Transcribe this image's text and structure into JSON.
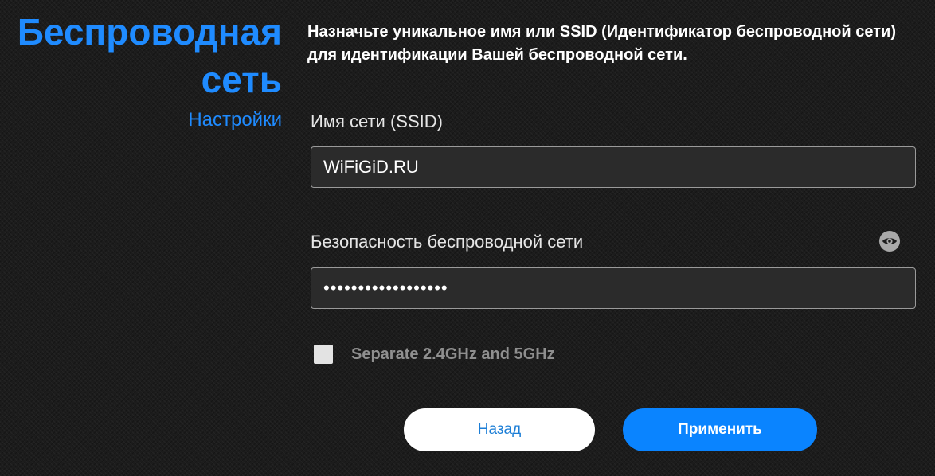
{
  "left_panel": {
    "title": "Беспроводная сеть",
    "subtitle": "Настройки"
  },
  "intro": "Назначьте уникальное имя или SSID (Идентификатор беспроводной сети) для идентификации Вашей беспроводной сети.",
  "ssid": {
    "label": "Имя сети (SSID)",
    "value": "WiFiGiD.RU"
  },
  "security": {
    "label": "Безопасность беспроводной сети",
    "value": "••••••••••••••••••",
    "toggle_icon": "eye-icon"
  },
  "separate_bands": {
    "label": "Separate 2.4GHz and 5GHz",
    "checked": false
  },
  "buttons": {
    "back": "Назад",
    "apply": "Применить"
  },
  "colors": {
    "accent": "#1f8bff",
    "primary_button": "#0a84ff",
    "background": "#1c1c1c"
  }
}
